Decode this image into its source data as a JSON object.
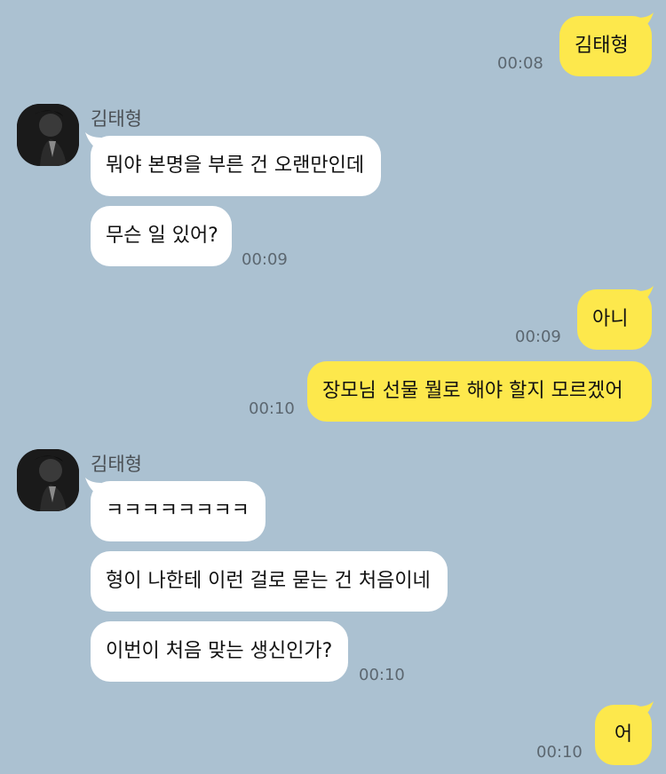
{
  "contact": {
    "name": "김태형"
  },
  "messages": [
    {
      "from": "me",
      "text": "김태형",
      "time": "00:08"
    },
    {
      "from": "other",
      "text": "뭐야 본명을 부른 건 오랜만인데",
      "time": ""
    },
    {
      "from": "other",
      "text": "무슨 일 있어?",
      "time": "00:09"
    },
    {
      "from": "me",
      "text": "아니",
      "time": "00:09"
    },
    {
      "from": "me",
      "text": "장모님 선물 뭘로 해야 할지 모르겠어",
      "time": "00:10"
    },
    {
      "from": "other",
      "text": "ㅋㅋㅋㅋㅋㅋㅋㅋ",
      "time": ""
    },
    {
      "from": "other",
      "text": "형이 나한테 이런 걸로 묻는 건 처음이네",
      "time": ""
    },
    {
      "from": "other",
      "text": "이번이 처음 맞는 생신인가?",
      "time": "00:10"
    },
    {
      "from": "me",
      "text": "어",
      "time": "00:10"
    }
  ],
  "colors": {
    "background": "#abc1d1",
    "my_bubble": "#fde84c",
    "their_bubble": "#ffffff",
    "timestamp": "#5c6770"
  }
}
